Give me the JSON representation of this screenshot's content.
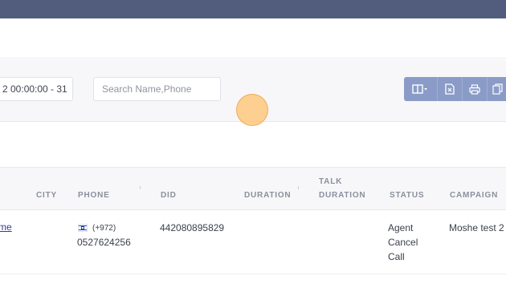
{
  "filters": {
    "date_range_value": "2 00:00:00 - 31",
    "search_placeholder": "Search Name,Phone"
  },
  "toolbar": {
    "icons": [
      "columns-icon",
      "excel-icon",
      "print-icon",
      "copy-icon"
    ]
  },
  "table": {
    "headers": {
      "city": "CITY",
      "phone": "PHONE",
      "did": "DID",
      "duration": "DURATION",
      "talk_duration_1": "TALK",
      "talk_duration_2": "DURATION",
      "status": "STATUS",
      "campaign": "CAMPAIGN"
    },
    "rows": [
      {
        "name": "me",
        "phone_code": "(+972)",
        "phone_number": "0527624256",
        "did": "442080895829",
        "duration": "",
        "talk_duration": "",
        "status_1": "Agent",
        "status_2": "Cancel",
        "status_3": "Call",
        "campaign": "Moshe test 2"
      }
    ]
  },
  "colors": {
    "topbar": "#525d7e",
    "button_group": "#8a9bc7",
    "link": "#2f3e8e"
  }
}
